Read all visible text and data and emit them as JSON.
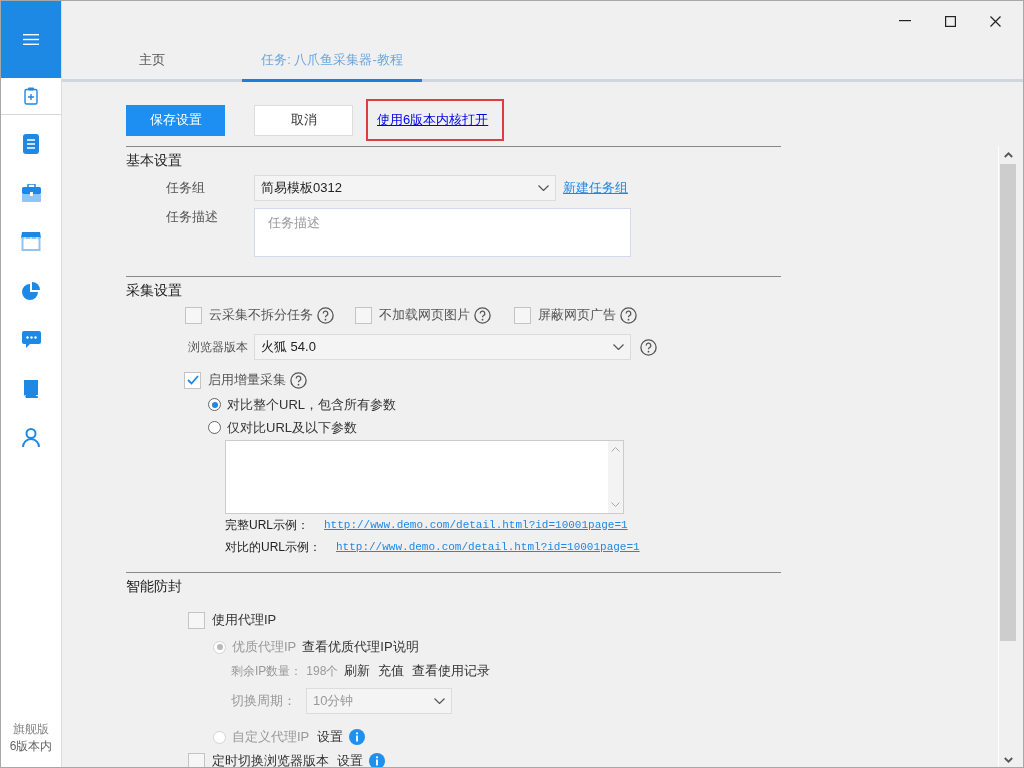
{
  "sidebar": {
    "items": [
      {
        "kind": "clipboard",
        "selected": true
      },
      {
        "kind": "document",
        "selected": false
      },
      {
        "kind": "briefcase",
        "selected": false
      },
      {
        "kind": "store",
        "selected": false
      },
      {
        "kind": "pie",
        "selected": false
      },
      {
        "kind": "chat",
        "selected": false
      },
      {
        "kind": "book",
        "selected": false
      },
      {
        "kind": "person",
        "selected": false
      }
    ],
    "footer": [
      "旗舰版",
      "6版本内"
    ]
  },
  "tabs": [
    {
      "label": "主页",
      "selected": false
    },
    {
      "label": "任务: 八爪鱼采集器-教程",
      "selected": true
    }
  ],
  "toolbar": {
    "save": "保存设置",
    "cancel": "取消",
    "link": {
      "label": "使用6版本内核打开",
      "highlighted": true
    }
  },
  "basic": {
    "title": "基本设置",
    "group_label": "任务组",
    "group_value": "简易模板0312",
    "new_group_link": "新建任务组",
    "desc_label": "任务描述",
    "desc_placeholder": "任务描述"
  },
  "collect": {
    "title": "采集设置",
    "options": [
      {
        "label": "云采集不拆分任务",
        "checked": false
      },
      {
        "label": "不加载网页图片",
        "checked": false
      },
      {
        "label": "屏蔽网页广告",
        "checked": false
      }
    ],
    "browser_label": "浏览器版本",
    "browser_value": "火狐 54.0",
    "incremental": {
      "label": "启用增量采集",
      "checked": true
    },
    "modes": [
      {
        "label": "对比整个URL，包含所有参数",
        "selected": true
      },
      {
        "label": "仅对比URL及以下参数",
        "selected": false
      }
    ],
    "examples": [
      {
        "label": "完整URL示例：",
        "url": "http://www.demo.com/detail.html?id=10001page=1"
      },
      {
        "label": "对比的URL示例：",
        "url": "http://www.demo.com/detail.html?id=10001page=1"
      }
    ]
  },
  "antiblock": {
    "title": "智能防封",
    "proxy": {
      "label": "使用代理IP",
      "checked": false
    },
    "premium": {
      "label": "优质代理IP",
      "selected": true,
      "disabled": true,
      "link": "查看优质代理IP说明"
    },
    "remaining_label": "剩余IP数量：",
    "remaining_value": "198个",
    "actions": [
      "刷新",
      "充值",
      "查看使用记录"
    ],
    "period_label": "切换周期：",
    "period_value": "10分钟",
    "custom": {
      "label": "自定义代理IP",
      "selected": false,
      "disabled": true,
      "setting": "设置"
    },
    "timed": {
      "label": "定时切换浏览器版本",
      "checked": false,
      "setting": "设置"
    }
  }
}
